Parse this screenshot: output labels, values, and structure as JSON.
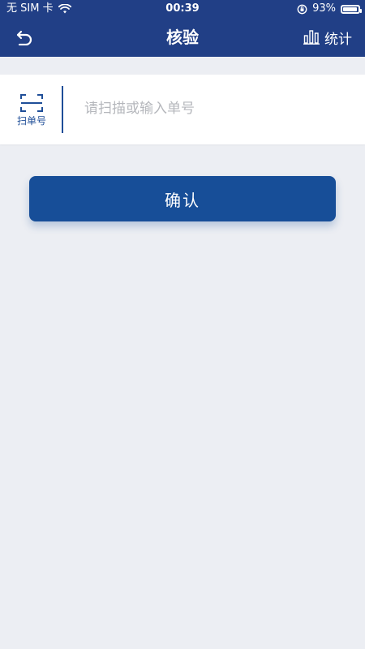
{
  "status_bar": {
    "carrier": "无 SIM 卡",
    "time": "00:39",
    "battery_percent": "93%",
    "battery_level": 0.93
  },
  "nav": {
    "title": "核验",
    "back_icon": "back-arrow-icon",
    "stats_label": "统计",
    "stats_icon": "bar-chart-icon"
  },
  "scan": {
    "button_label": "扫单号",
    "icon": "scan-frame-icon",
    "input_placeholder": "请扫描或输入单号",
    "input_value": ""
  },
  "confirm": {
    "label": "确认"
  },
  "colors": {
    "header_blue": "#213F86",
    "accent_blue": "#174E98",
    "background": "#ECEEF3"
  }
}
